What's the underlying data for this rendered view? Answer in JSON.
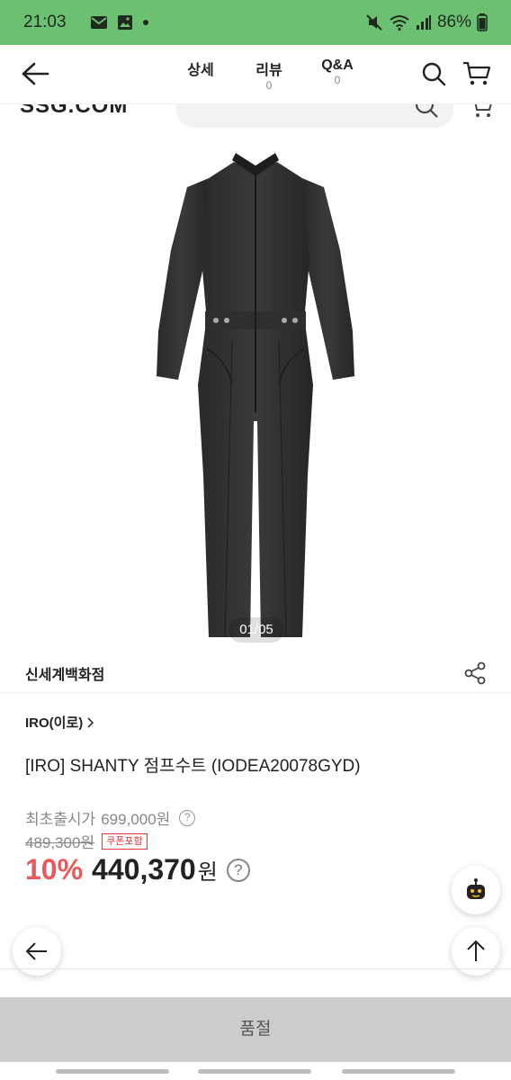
{
  "status_bar": {
    "time": "21:03",
    "battery": "86%",
    "left_icons": [
      "mail-icon",
      "image-icon",
      "dot-icon"
    ],
    "right_icons": [
      "mute-icon",
      "wifi-icon",
      "signal-icon",
      "battery-icon"
    ]
  },
  "header": {
    "tabs": [
      {
        "label": "상세",
        "count": ""
      },
      {
        "label": "리뷰",
        "count": "0"
      },
      {
        "label": "Q&A",
        "count": "0"
      }
    ]
  },
  "behind": {
    "logo": "SSG.COM"
  },
  "gallery": {
    "counter": "01/05"
  },
  "store": {
    "name": "신세계백화점"
  },
  "product": {
    "brand": "IRO(이로)",
    "title": "[IRO] SHANTY 점프수트 (IODEA20078GYD)",
    "first_price_label": "최초출시가",
    "first_price": "699,000원",
    "original_price": "489,300원",
    "coupon_badge": "쿠폰포함",
    "discount": "10%",
    "sale_price": "440,370",
    "currency": "원"
  },
  "bottom": {
    "soldout_label": "품절"
  },
  "colors": {
    "status_bar": "#6cc071",
    "discount": "#e85a5a",
    "coupon": "#e0393e",
    "soldout_bar": "#cccccc"
  }
}
